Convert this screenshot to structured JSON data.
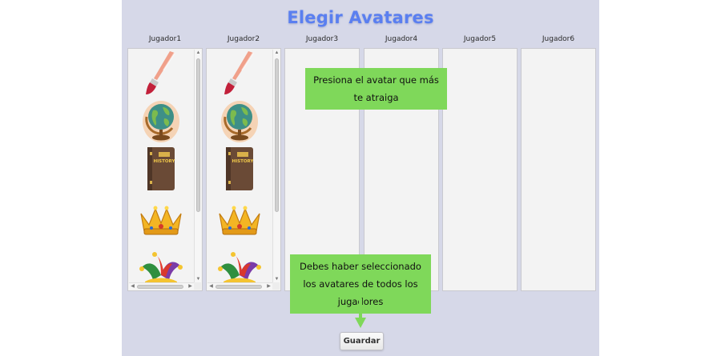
{
  "window": {
    "title": "Elegir Avatares"
  },
  "players": [
    {
      "label": "Jugador1",
      "has_avatars": true
    },
    {
      "label": "Jugador2",
      "has_avatars": true
    },
    {
      "label": "Jugador3",
      "has_avatars": false
    },
    {
      "label": "Jugador4",
      "has_avatars": false
    },
    {
      "label": "Jugador5",
      "has_avatars": false
    },
    {
      "label": "Jugador6",
      "has_avatars": false
    }
  ],
  "avatars": [
    "brush-icon",
    "globe-icon",
    "history-book-icon",
    "crown-icon",
    "jester-hat-icon"
  ],
  "book_label": "HISTORY",
  "tips": {
    "choose": "Presiona el avatar que más te atraiga",
    "must_select": "Debes haber seleccionado los avatares de todos los jugadores"
  },
  "actions": {
    "save_label": "Guardar"
  },
  "colors": {
    "title": "#5a7ff0",
    "background": "#d6d8e8",
    "tip": "#7fd85a",
    "arrow": "#7fd85a"
  }
}
